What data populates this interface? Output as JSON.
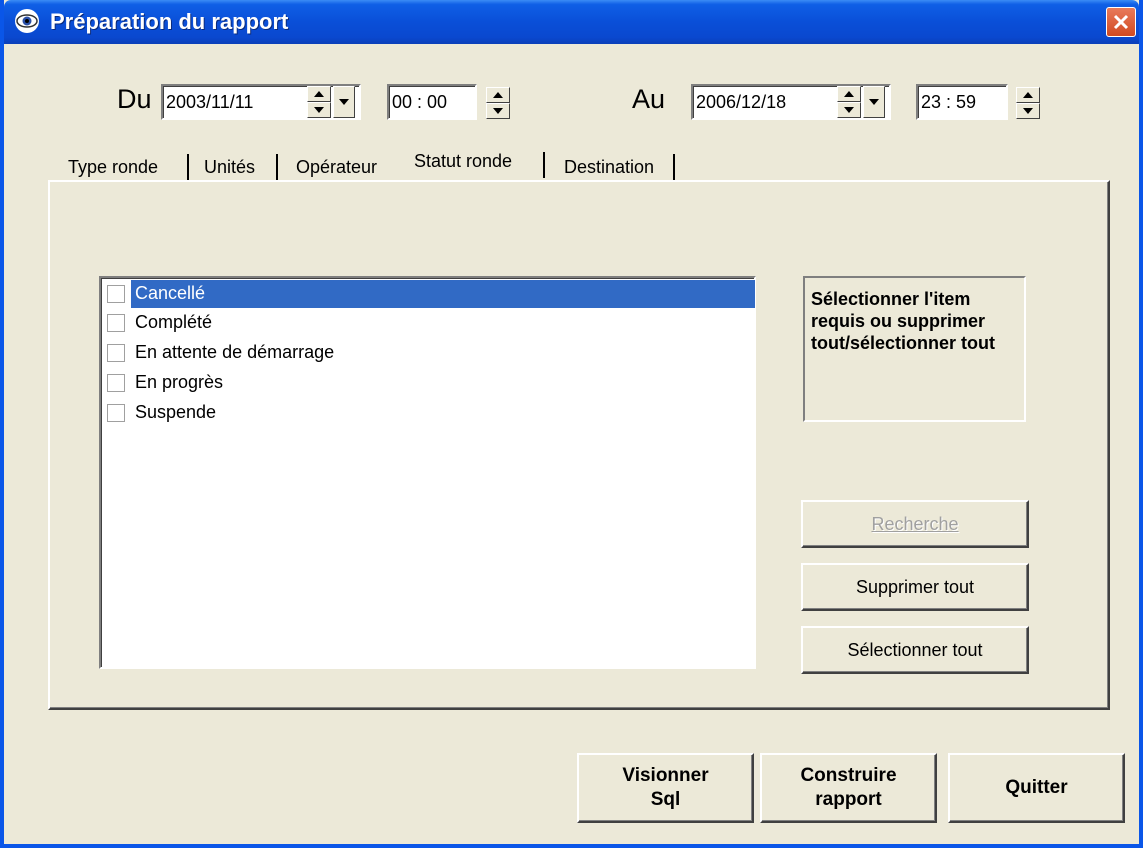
{
  "window": {
    "title": "Préparation du rapport"
  },
  "date_range": {
    "from_label": "Du",
    "from_date": "2003/11/11",
    "from_time": "00 : 00",
    "to_label": "Au",
    "to_date": "2006/12/18",
    "to_time": "23 : 59"
  },
  "tabs": [
    {
      "label": "Type ronde"
    },
    {
      "label": "Unités"
    },
    {
      "label": "Opérateur"
    },
    {
      "label": "Statut ronde",
      "active": true
    },
    {
      "label": "Destination"
    }
  ],
  "list": {
    "items": [
      {
        "label": "Cancellé",
        "checked": false,
        "selected": true
      },
      {
        "label": "Complété",
        "checked": false
      },
      {
        "label": "En attente de démarrage",
        "checked": false
      },
      {
        "label": "En progrès",
        "checked": false
      },
      {
        "label": "Suspende",
        "checked": false
      }
    ]
  },
  "info": {
    "text": "Sélectionner l'item requis ou supprimer tout/sélectionner tout"
  },
  "buttons": {
    "search": "Recherche",
    "clear_all": "Supprimer tout",
    "select_all": "Sélectionner tout",
    "view_sql_line1": "Visionner",
    "view_sql_line2": "Sql",
    "build_line1": "Construire",
    "build_line2": "rapport",
    "quit": "Quitter"
  },
  "colors": {
    "titlebar": "#0a4fd8",
    "selection": "#316ac5",
    "background": "#ece9d8"
  }
}
